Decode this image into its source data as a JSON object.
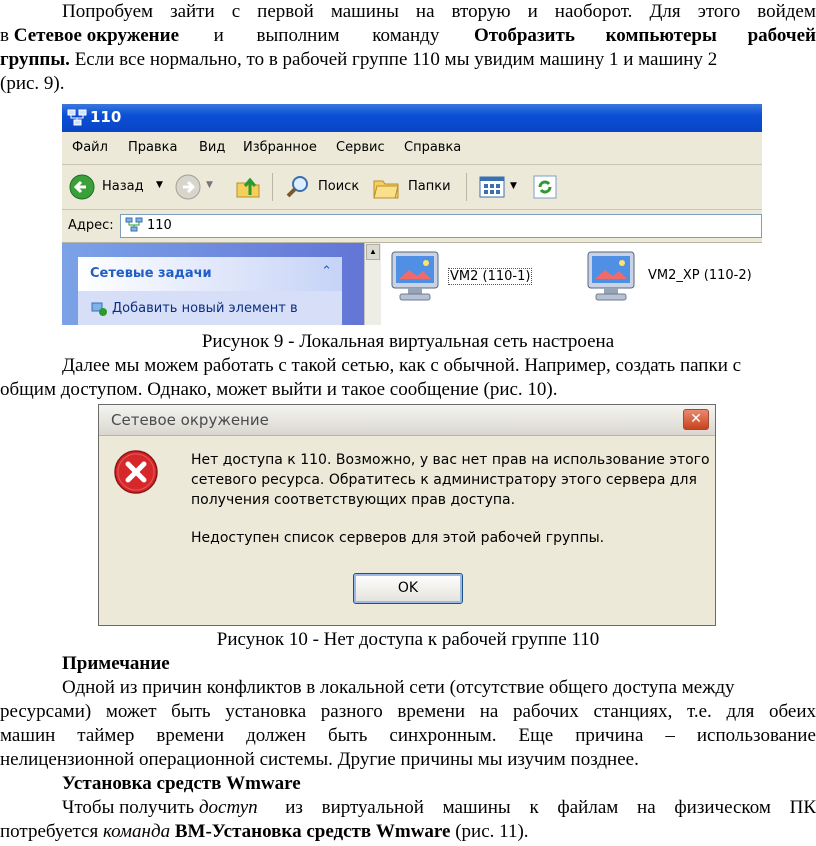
{
  "paragraph1": {
    "line1": [
      "Попробуем",
      "зайти",
      "с",
      "первой",
      "машины",
      "на",
      "вторую",
      "и",
      "наоборот.",
      "Для",
      "этого",
      "войдем"
    ],
    "line2_pre": "в",
    "line2_bold1": "Сетевое окружение",
    "line2_mid": "и выполним команду",
    "line2_bold2": "Отобразить компьютеры рабочей",
    "line3_bold": "группы.",
    "line3_rest": "Если все нормально, то в рабочей группе 110 мы увидим машину 1 и машину 2",
    "line4": "(рис. 9)."
  },
  "figure9": {
    "window_title": "110",
    "menu": [
      "Файл",
      "Правка",
      "Вид",
      "Избранное",
      "Сервис",
      "Справка"
    ],
    "toolbar": {
      "back": "Назад",
      "search": "Поиск",
      "folders": "Папки"
    },
    "address_label": "Адрес:",
    "address_value": "110",
    "tasks_header": "Сетевые задачи",
    "task_item": "Добавить новый элемент в",
    "computers": [
      "VM2 (110-1)",
      "VM2_XP (110-2)"
    ],
    "caption": "Рисунок 9 - Локальная виртуальная сеть настроена"
  },
  "paragraph2": {
    "line1": "Далее мы можем работать с такой сетью, как с обычной. Например, создать папки с",
    "line2": "общим доступом. Однако, может выйти и такое сообщение (рис. 10)."
  },
  "figure10": {
    "dialog_title": "Сетевое окружение",
    "message_lines": [
      "Нет доступа к 110. Возможно, у вас нет прав на использование этого",
      "сетевого ресурса. Обратитесь к администратору этого сервера для",
      "получения соответствующих прав доступа."
    ],
    "message_line4": "Недоступен список серверов для этой рабочей группы.",
    "ok_label": "OK",
    "caption": "Рисунок 10 - Нет доступа к рабочей группе 110"
  },
  "note": {
    "heading": "Примечание",
    "line1": "Одной из причин конфликтов в локальной сети (отсутствие общего доступа между",
    "line2": [
      "ресурсами)",
      "может",
      "быть",
      "установка",
      "разного",
      "времени",
      "на",
      "рабочих",
      "станциях,",
      "т.е.",
      "для",
      "обеих"
    ],
    "line3": [
      "машин",
      "таймер",
      "времени",
      "должен",
      "быть",
      "синхронным.",
      "Еще",
      "причина",
      "–",
      "использование"
    ],
    "line4": "нелицензионной операционной системы. Другие причины мы изучим позднее."
  },
  "section": {
    "heading": "Установка средств Wmware",
    "line1_pre": "Чтобы получить",
    "line1_italic": "доступ",
    "line1_rest": "из виртуальной машины к файлам на физическом ПК",
    "line2_pre": "потребуется",
    "line2_italic": "команда",
    "line2_bold": "ВМ-Установка средств Wmware",
    "line2_post": "(рис. 11)."
  },
  "colors": {
    "xp_blue": "#0b4fd6",
    "error_red": "#d6272b",
    "dialog_bg": "#ece9d8"
  }
}
